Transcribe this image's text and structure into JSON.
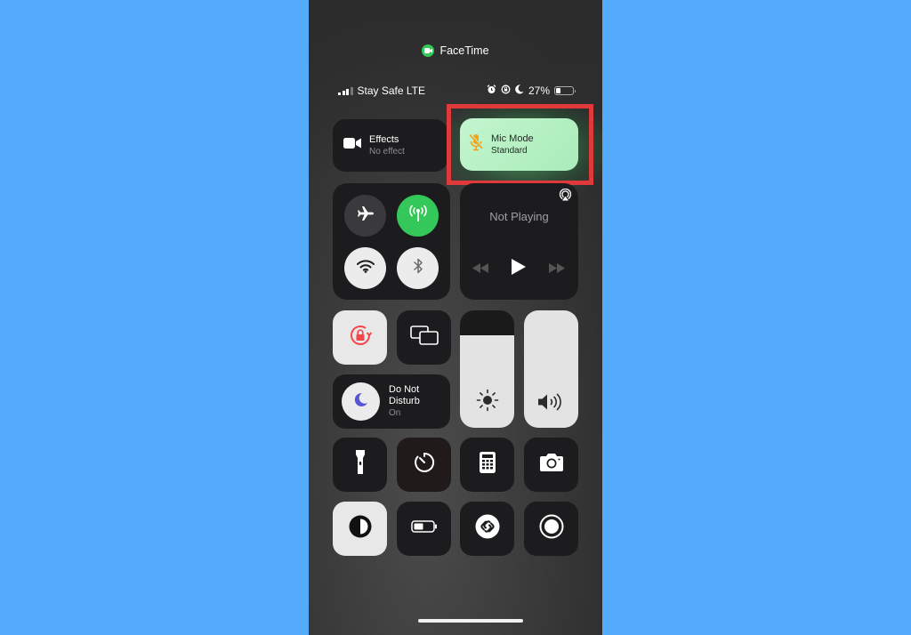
{
  "active_call": {
    "app": "FaceTime",
    "indicator_color": "#34c759"
  },
  "status_bar": {
    "carrier": "Stay Safe LTE",
    "signal_bars": 3,
    "signal_bars_max": 4,
    "icons": [
      "alarm-icon",
      "orientation-lock-icon",
      "moon-icon"
    ],
    "battery_percent": "27%",
    "battery_level": 0.27
  },
  "effects_tile": {
    "title": "Effects",
    "subtitle": "No effect",
    "icon": "video-camera-icon"
  },
  "mic_mode_tile": {
    "title": "Mic Mode",
    "subtitle": "Standard",
    "icon": "mic-slash-icon",
    "highlighted": true,
    "highlight_color": "#e0393b"
  },
  "connectivity": {
    "airplane_mode": {
      "label": "Airplane Mode",
      "on": false
    },
    "cellular_data": {
      "label": "Cellular Data",
      "on": true,
      "color": "#34c759"
    },
    "wifi": {
      "label": "Wi-Fi",
      "on": false
    },
    "bluetooth": {
      "label": "Bluetooth",
      "on": false
    }
  },
  "media": {
    "status": "Not Playing",
    "airplay_icon": "airplay-icon"
  },
  "orientation_lock": {
    "label": "Orientation Lock",
    "on": true,
    "color": "#f1484c"
  },
  "screen_mirroring": {
    "label": "Screen Mirroring"
  },
  "brightness": {
    "label": "Brightness",
    "level": 0.79
  },
  "volume": {
    "label": "Volume",
    "level": 1.0
  },
  "do_not_disturb": {
    "title_line1": "Do Not",
    "title_line2": "Disturb",
    "state": "On",
    "icon_color": "#5856d6"
  },
  "shortcuts_row1": [
    "Flashlight",
    "Timer",
    "Calculator",
    "Camera"
  ],
  "shortcuts_row2": [
    "Dark Mode",
    "Low Power Mode",
    "Shazam",
    "Screen Recording"
  ]
}
